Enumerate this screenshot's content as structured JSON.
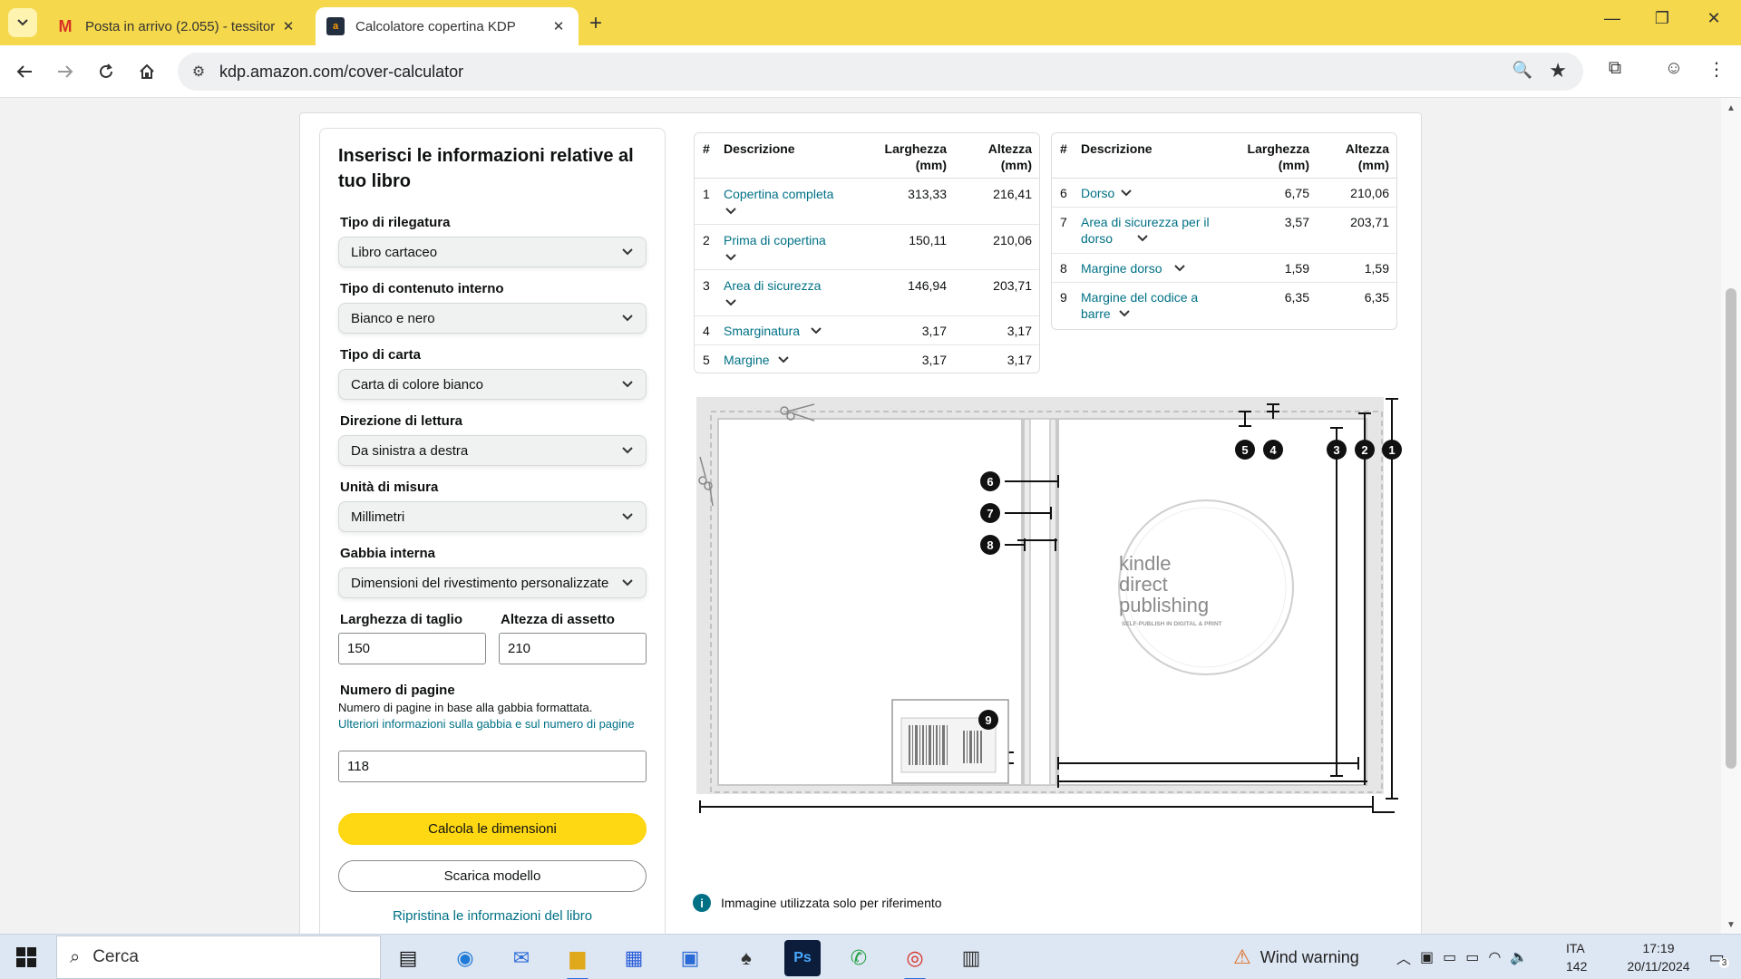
{
  "browser": {
    "tabs": [
      {
        "title": "Posta in arrivo (2.055) - tessitor",
        "icon": "gmail-icon",
        "active": false
      },
      {
        "title": "Calcolatore copertina KDP",
        "icon": "amazon-icon",
        "active": true
      }
    ],
    "url": "kdp.amazon.com/cover-calculator"
  },
  "form": {
    "title": "Inserisci le informazioni relative al tuo libro",
    "binding_label": "Tipo di rilegatura",
    "binding_value": "Libro cartaceo",
    "interior_label": "Tipo di contenuto interno",
    "interior_value": "Bianco e nero",
    "paper_label": "Tipo di carta",
    "paper_value": "Carta di colore bianco",
    "reading_label": "Direzione di lettura",
    "reading_value": "Da sinistra a destra",
    "unit_label": "Unità di misura",
    "unit_value": "Millimetri",
    "trim_label": "Gabbia interna",
    "trim_value": "Dimensioni del rivestimento personalizzate",
    "width_label": "Larghezza di taglio",
    "width_value": "150",
    "height_label": "Altezza di assetto",
    "height_value": "210",
    "pages_label": "Numero di pagine",
    "pages_help": "Numero di pagine in base alla gabbia formattata.",
    "pages_link": "Ulteriori informazioni sulla gabbia e sul numero di pagine",
    "pages_value": "118",
    "calc_button": "Calcola le dimensioni",
    "download_button": "Scarica modello",
    "reset_link": "Ripristina le informazioni del libro"
  },
  "table_headers": {
    "hash": "#",
    "description": "Descrizione",
    "width": "Larghezza (mm)",
    "height": "Altezza (mm)"
  },
  "table_left": [
    {
      "n": "1",
      "desc": "Copertina completa",
      "w": "313,33",
      "h": "216,41"
    },
    {
      "n": "2",
      "desc": "Prima di copertina",
      "w": "150,11",
      "h": "210,06"
    },
    {
      "n": "3",
      "desc": "Area di sicurezza",
      "w": "146,94",
      "h": "203,71"
    },
    {
      "n": "4",
      "desc": "Smarginatura",
      "w": "3,17",
      "h": "3,17"
    },
    {
      "n": "5",
      "desc": "Margine",
      "w": "3,17",
      "h": "3,17"
    }
  ],
  "table_right": [
    {
      "n": "6",
      "desc": "Dorso",
      "w": "6,75",
      "h": "210,06"
    },
    {
      "n": "7",
      "desc": "Area di sicurezza per il dorso",
      "w": "3,57",
      "h": "203,71"
    },
    {
      "n": "8",
      "desc": "Margine dorso",
      "w": "1,59",
      "h": "1,59"
    },
    {
      "n": "9",
      "desc": "Margine del codice a barre",
      "w": "6,35",
      "h": "6,35"
    }
  ],
  "diagram": {
    "logo_line1": "kindle",
    "logo_line2": "direct",
    "logo_line3": "publishing",
    "logo_tagline": "SELF-PUBLISH IN DIGITAL & PRINT",
    "markers": [
      "1",
      "2",
      "3",
      "4",
      "5",
      "6",
      "7",
      "8",
      "9"
    ],
    "note": "Immagine utilizzata solo per riferimento"
  },
  "taskbar": {
    "search_placeholder": "Cerca",
    "weather": "Wind warning",
    "language": "ITA",
    "lang_sub": "142",
    "time": "17:19",
    "date": "20/11/2024",
    "notifications": "3"
  }
}
